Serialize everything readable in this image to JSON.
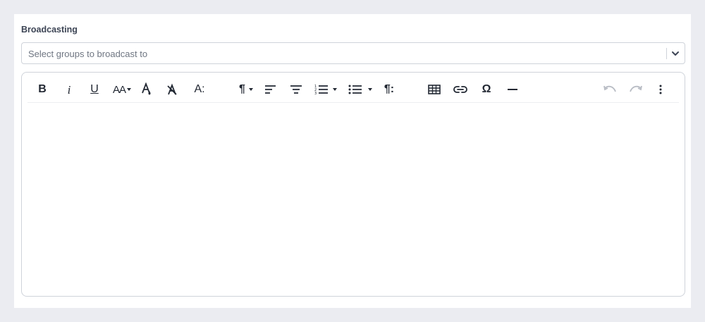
{
  "broadcast": {
    "label": "Broadcasting",
    "select_placeholder": "Select groups to broadcast to"
  },
  "editor": {
    "content": "",
    "toolbar": {
      "bold_label": "B",
      "italic_label": "i",
      "underline_label": "U",
      "font_size_label": "AA",
      "line_height_label": "A:",
      "paragraph_label": "¶",
      "paragraph_style_label": "¶:",
      "special_char_label": "Ω"
    }
  }
}
